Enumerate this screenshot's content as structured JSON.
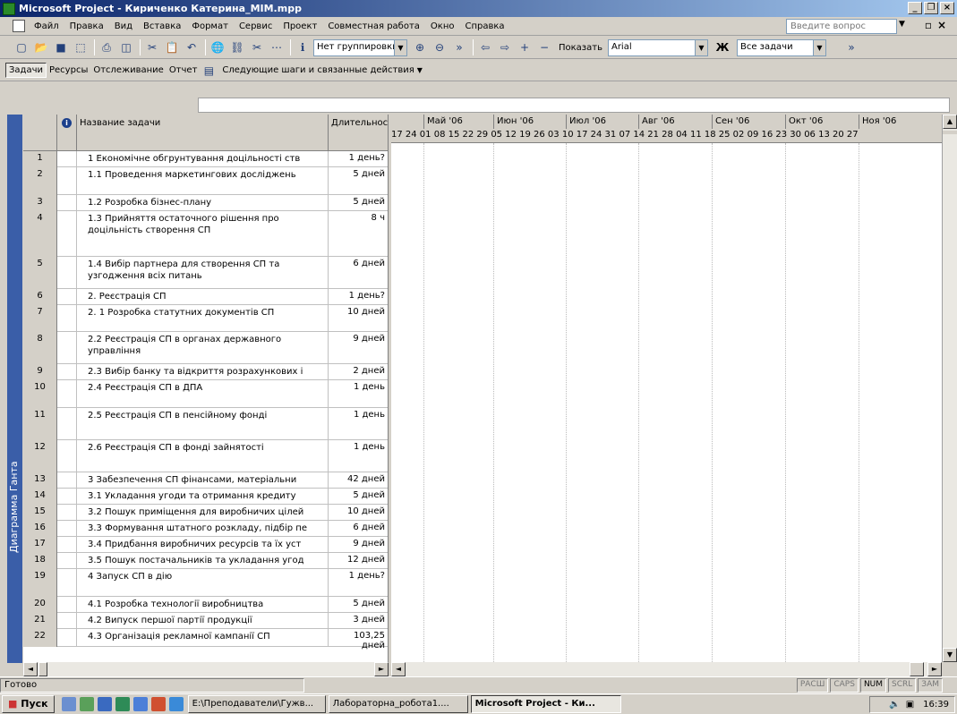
{
  "window": {
    "title": "Microsoft Project - Кириченко Катерина_MIM.mpp"
  },
  "menu": {
    "items": [
      "Файл",
      "Правка",
      "Вид",
      "Вставка",
      "Формат",
      "Сервис",
      "Проект",
      "Совместная работа",
      "Окно",
      "Справка"
    ],
    "ask_placeholder": "Введите вопрос"
  },
  "toolbar": {
    "grouping": "Нет группировки",
    "show_label": "Показать",
    "font": "Arial",
    "bold": "Ж",
    "filter": "Все задачи"
  },
  "guide": {
    "tasks": "Задачи",
    "resources": "Ресурсы",
    "tracking": "Отслеживание",
    "report": "Отчет",
    "next_steps": "Следующие шаги и связанные действия"
  },
  "view": {
    "label": "Диаграмма Ганта"
  },
  "table": {
    "headers": {
      "name": "Название задачи",
      "duration": "Длительность"
    },
    "rows": [
      {
        "id": "1",
        "name": "1 Економічне обгрунтування доцільності ств",
        "duration": "1 день?"
      },
      {
        "id": "2",
        "name": "1.1 Проведення маркетингових досліджень",
        "duration": "5 дней"
      },
      {
        "id": "3",
        "name": "1.2 Розробка бізнес-плану",
        "duration": "5 дней"
      },
      {
        "id": "4",
        "name": "1.3 Прийняття остаточного рішення про доцільність створення СП",
        "duration": "8 ч"
      },
      {
        "id": "5",
        "name": "1.4 Вибір партнера для створення СП та узгодження всіх питань",
        "duration": "6 дней"
      },
      {
        "id": "6",
        "name": "2. Реєстрація СП",
        "duration": "1 день?"
      },
      {
        "id": "7",
        "name": "2. 1 Розробка статутних документів СП",
        "duration": "10 дней"
      },
      {
        "id": "8",
        "name": "2.2 Реєстрація СП в органах державного управління",
        "duration": "9 дней"
      },
      {
        "id": "9",
        "name": "2.3 Вибір банку та відкриття розрахункових і",
        "duration": "2 дней"
      },
      {
        "id": "10",
        "name": "2.4 Реєстрація СП в ДПА",
        "duration": "1 день"
      },
      {
        "id": "11",
        "name": "2.5 Реєстрація СП в пенсійному фонді",
        "duration": "1 день"
      },
      {
        "id": "12",
        "name": "2.6 Реєстрація СП в фонді зайнятості",
        "duration": "1 день"
      },
      {
        "id": "13",
        "name": "3 Забезпечення СП фінансами, матеріальни",
        "duration": "42 дней"
      },
      {
        "id": "14",
        "name": "3.1 Укладання угоди та отримання кредиту",
        "duration": "5 дней"
      },
      {
        "id": "15",
        "name": "3.2 Пошук приміщення для виробничих цілей",
        "duration": "10 дней"
      },
      {
        "id": "16",
        "name": "3.3 Формування штатного розкладу, підбір пе",
        "duration": "6 дней"
      },
      {
        "id": "17",
        "name": "3.4 Придбання виробничих ресурсів та їх уст",
        "duration": "9 дней"
      },
      {
        "id": "18",
        "name": "3.5 Пошук постачальників та укладання угод",
        "duration": "12 дней"
      },
      {
        "id": "19",
        "name": "4 Запуск СП в дію",
        "duration": "1 день?"
      },
      {
        "id": "20",
        "name": "4.1 Розробка технології виробництва",
        "duration": "5 дней"
      },
      {
        "id": "21",
        "name": "4.2 Випуск першої партії продукції",
        "duration": "3 дней"
      },
      {
        "id": "22",
        "name": "4.3 Організація рекламної кампанії СП",
        "duration": "103,25 дней"
      }
    ]
  },
  "gantt": {
    "months": [
      "Май '06",
      "Июн '06",
      "Июл '06",
      "Авг '06",
      "Сен '06",
      "Окт '06",
      "Ноя '06"
    ],
    "days": "17 24 01 08 15 22 29 05 12 19 26 03 10 17 24 31 07 14 21 28 04 11 18 25 02 09 16 23 30 06 13 20 27"
  },
  "status": {
    "text": "Готово",
    "indicators": [
      "РАСШ",
      "CAPS",
      "NUM",
      "SCRL",
      "ЗАМ"
    ]
  },
  "taskbar": {
    "start": "Пуск",
    "tasks": [
      "E:\\Преподаватели\\Гужв...",
      "Лабораторна_робота1....",
      "Microsoft Project - Ки..."
    ],
    "clock": "16:39"
  }
}
